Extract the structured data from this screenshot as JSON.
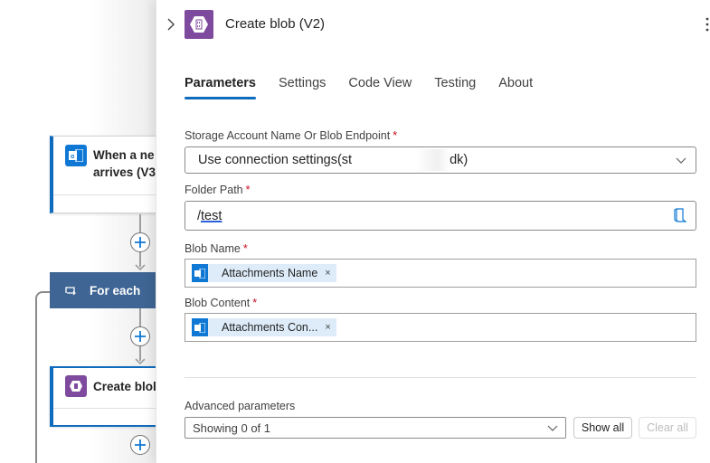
{
  "canvas": {
    "trigger": {
      "title_line1": "When a ne",
      "title_line2": "arrives (V3",
      "icon": "outlook-icon",
      "accent": "#0f6cbd"
    },
    "foreach": {
      "label": "For each",
      "icon": "loop-icon",
      "color": "#3e6593"
    },
    "action": {
      "title": "Create blol",
      "icon": "azure-blob-icon",
      "color": "#7e4a9e"
    }
  },
  "panel": {
    "title": "Create blob (V2)",
    "icon": "azure-blob-icon",
    "tabs": [
      {
        "label": "Parameters",
        "active": true
      },
      {
        "label": "Settings",
        "active": false
      },
      {
        "label": "Code View",
        "active": false
      },
      {
        "label": "Testing",
        "active": false
      },
      {
        "label": "About",
        "active": false
      }
    ],
    "fields": {
      "storage": {
        "label": "Storage Account Name Or Blob Endpoint",
        "required": "*",
        "value_start": "Use connection settings(st",
        "value_end": "dk)"
      },
      "folder": {
        "label": "Folder Path",
        "required": "*",
        "value_prefix": "/",
        "value_underlined": "test"
      },
      "blob_name": {
        "label": "Blob Name",
        "required": "*",
        "token": "Attachments Name",
        "token_remove": "×"
      },
      "blob_content": {
        "label": "Blob Content",
        "required": "*",
        "token": "Attachments Con...",
        "token_remove": "×"
      }
    },
    "advanced": {
      "label": "Advanced parameters",
      "selected": "Showing 0 of 1",
      "show_all": "Show all",
      "clear_all": "Clear all"
    }
  },
  "colors": {
    "accent": "#0f6cbd",
    "blob_purple": "#7e4a9e",
    "outlook_blue": "#0f78d4",
    "required": "#c50f1f",
    "token_bg": "#deecf9"
  }
}
